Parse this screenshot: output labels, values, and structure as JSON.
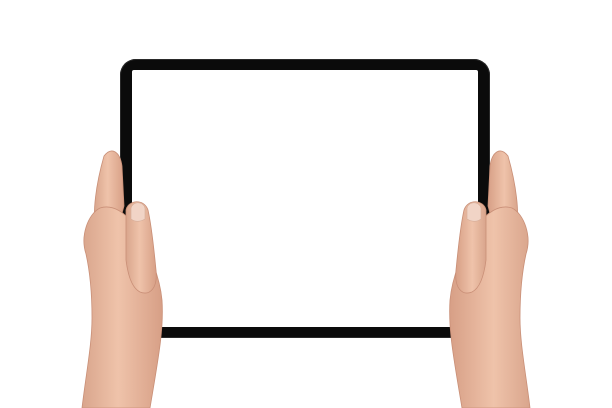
{
  "scene": {
    "background_color": "#ffffff",
    "device": {
      "kind": "tablet",
      "orientation": "landscape",
      "bezel_color": "#0b0b0b",
      "screen_color": "#ffffff",
      "screen_state": "blank"
    },
    "hands": {
      "count": 2,
      "skin_color": "#e8b9a0",
      "shadow_color": "#c98f77",
      "nail_color": "#f1d4c6"
    }
  }
}
